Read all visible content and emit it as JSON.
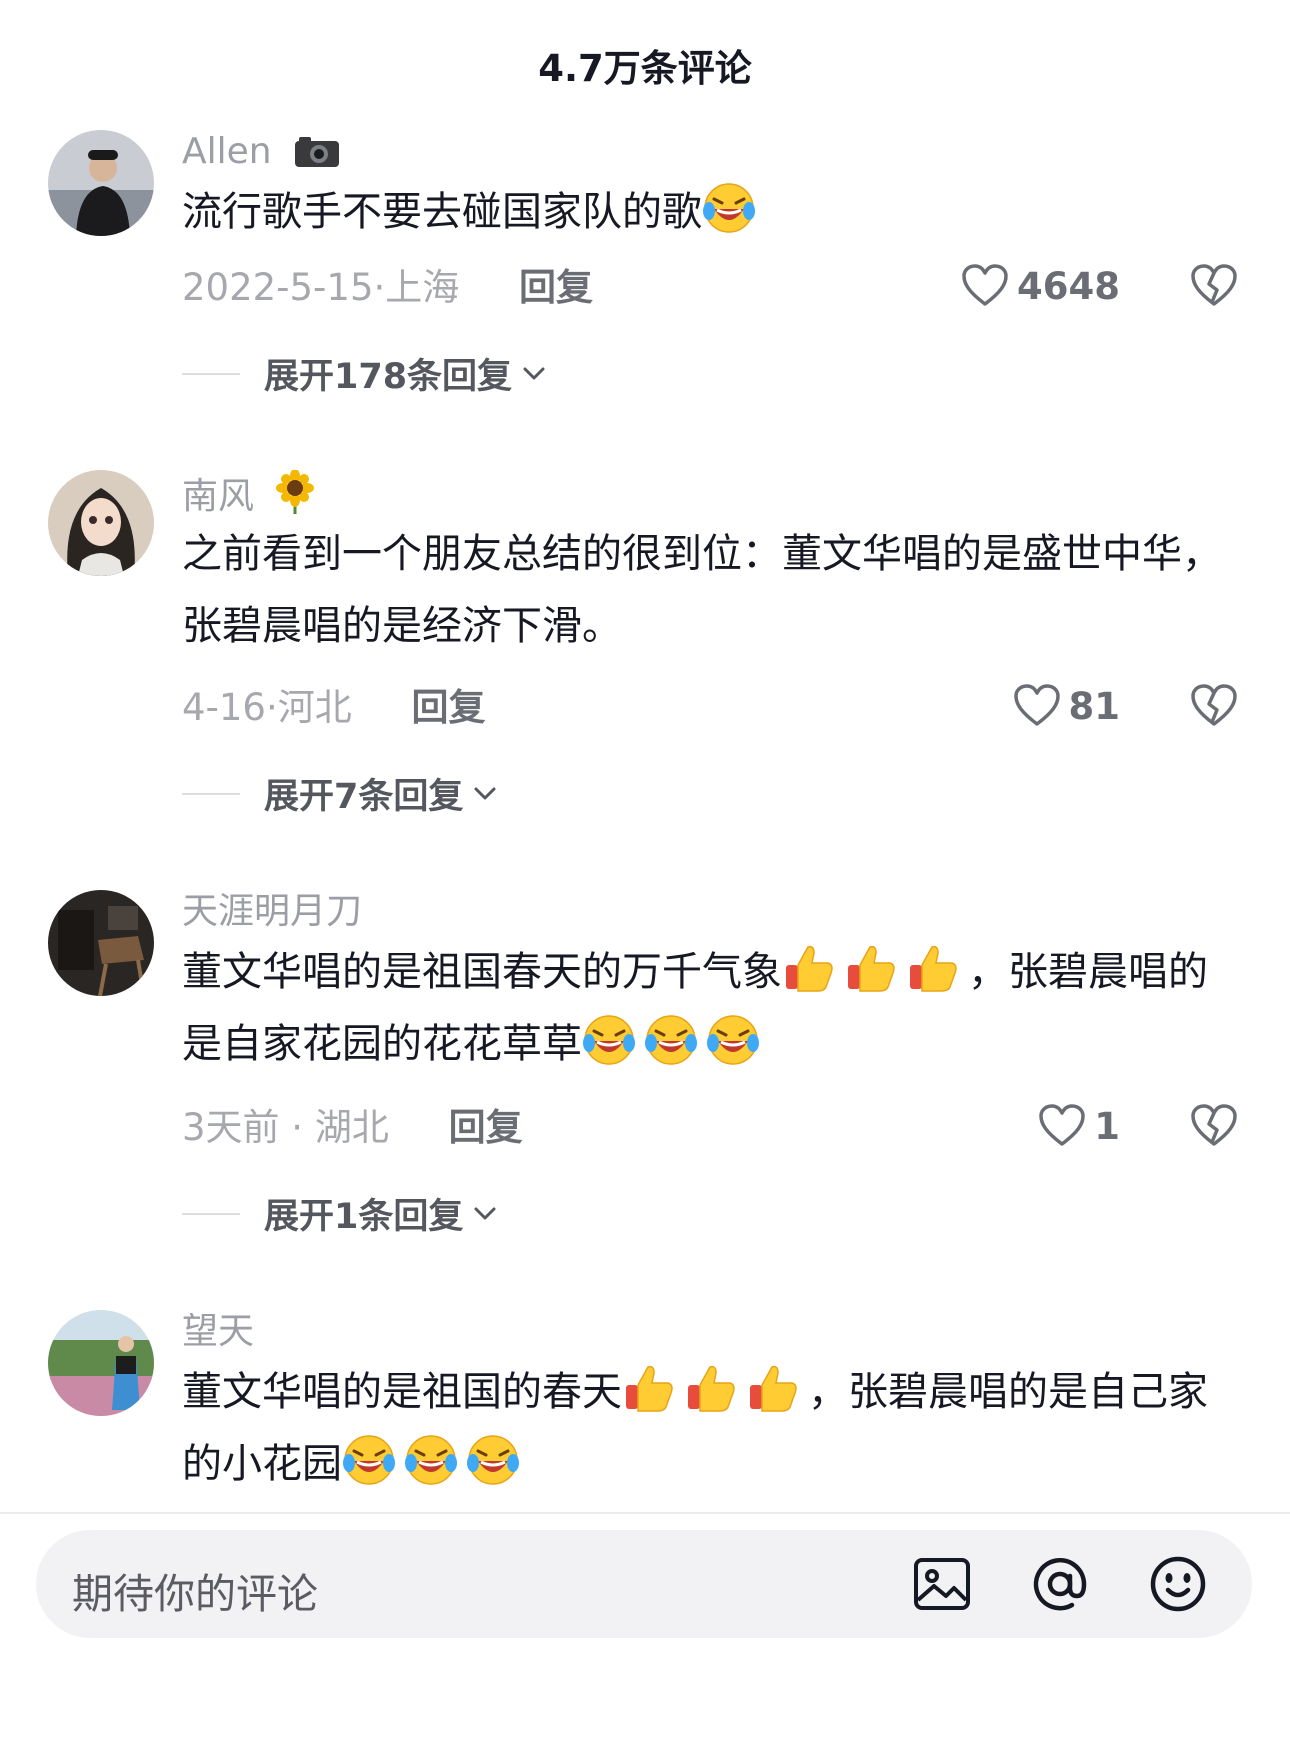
{
  "header": {
    "title": "4.7万条评论"
  },
  "comments": [
    {
      "user": "Allen",
      "user_badge": "camera-icon",
      "text": "流行歌手不要去碰国家队的歌",
      "emojis": [
        "laughing-crying-emoji"
      ],
      "date": "2022-5-15",
      "location": "上海",
      "reply_label": "回复",
      "likes": "4648",
      "expand_label": "展开178条回复"
    },
    {
      "user": "南风",
      "user_badge": "sunflower-icon",
      "text": "之前看到一个朋友总结的很到位：董文华唱的是盛世中华，张碧晨唱的是经济下滑。",
      "date": "4-16",
      "location": "河北",
      "reply_label": "回复",
      "likes": "81",
      "expand_label": "展开7条回复"
    },
    {
      "user": "天涯明月刀",
      "text_part1": "董文华唱的是祖国春天的万千气象",
      "text_part2": "，张碧晨唱的是自家花园的花花草草",
      "date": "3天前",
      "location": "湖北",
      "reply_label": "回复",
      "likes": "1",
      "expand_label": "展开1条回复"
    },
    {
      "user": "望天",
      "text_part1": "董文华唱的是祖国的春天",
      "text_part2": "，张碧晨唱的是自己家的小花园"
    }
  ],
  "input": {
    "placeholder": "期待你的评论"
  },
  "colors": {
    "text": "#161823",
    "secondary": "#a6a8ad",
    "input_bg": "#f2f2f4"
  }
}
